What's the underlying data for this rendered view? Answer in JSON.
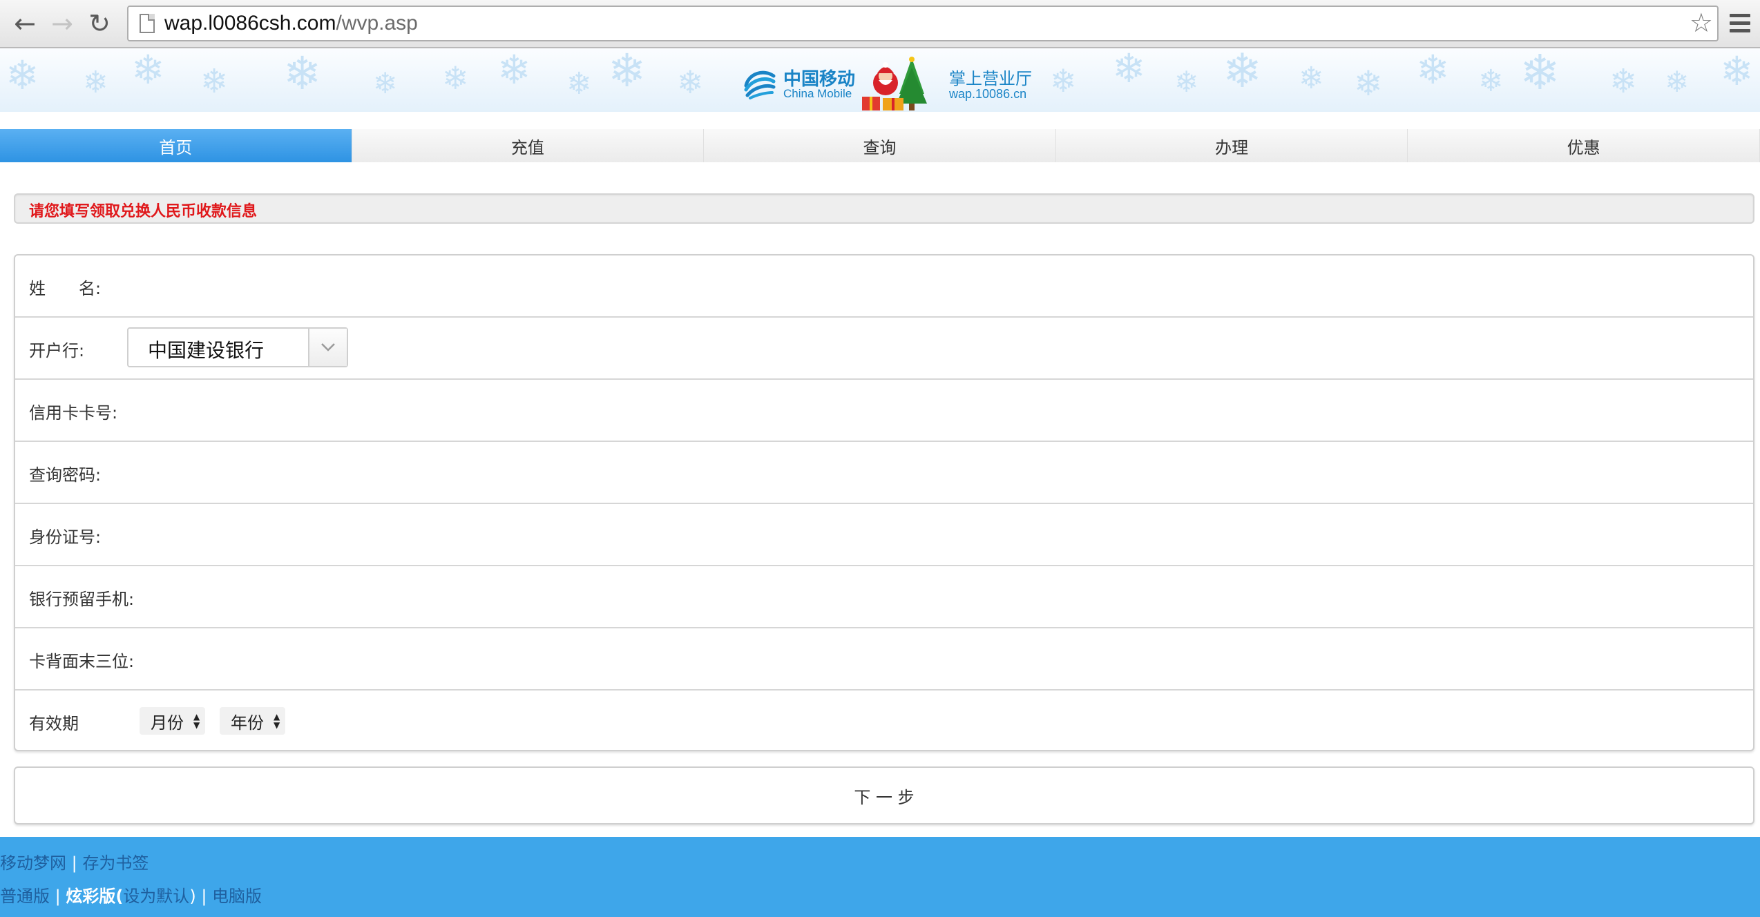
{
  "browser": {
    "url_host": "wap.l0086csh.com",
    "url_path": "/wvp.asp",
    "back_glyph": "←",
    "forward_glyph": "→",
    "reload_glyph": "↻",
    "star_glyph": "☆"
  },
  "banner": {
    "brand_cn": "中国移动",
    "brand_en": "China Mobile",
    "hall_cn": "掌上营业厅",
    "hall_url": "wap.10086.cn",
    "colors": {
      "brand": "#1a84c6",
      "snow": "#c8e2f6"
    }
  },
  "tabs": [
    {
      "label": "首页",
      "active": true
    },
    {
      "label": "充值",
      "active": false
    },
    {
      "label": "查询",
      "active": false
    },
    {
      "label": "办理",
      "active": false
    },
    {
      "label": "优惠",
      "active": false
    }
  ],
  "notice": {
    "text": "请您填写领取兑换人民币收款信息",
    "color": "#e0181b"
  },
  "form": {
    "name_label": "姓　　名:",
    "bank_label": "开户行:",
    "bank_value": "中国建设银行",
    "card_label": "信用卡卡号:",
    "password_label": "查询密码:",
    "id_label": "身份证号:",
    "phone_label": "银行预留手机:",
    "cvv_label": "卡背面末三位:",
    "expiry_label": "有效期",
    "month_value": "月份",
    "year_value": "年份"
  },
  "next_button": "下 一 步",
  "footer": {
    "link_dream": "移动梦网",
    "sep1": " | ",
    "link_bookmark": "存为书签",
    "link_normal": "普通版",
    "sep2": " | ",
    "link_color": "炫彩版",
    "paren_open": "(",
    "link_default": "设为默认",
    "paren_close": ")",
    "sep3": " | ",
    "link_pc": "电脑版",
    "colors": {
      "background": "#3ea6ea",
      "link": "#1f5f9e"
    }
  }
}
